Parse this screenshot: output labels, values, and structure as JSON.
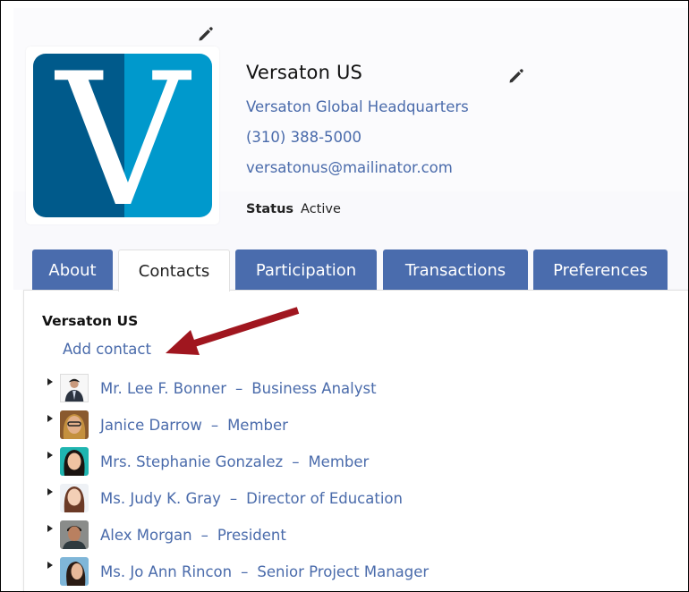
{
  "organization": {
    "name": "Versaton US",
    "subtitle": "Versaton Global Headquarters",
    "phone": "(310) 388-5000",
    "email": "versatonus@mailinator.com",
    "status_label": "Status",
    "status_value": "Active",
    "logo_letter": "V",
    "logo_colors": {
      "left": "#005a8b",
      "right": "#0099cc"
    }
  },
  "tabs": [
    {
      "label": "About",
      "active": false
    },
    {
      "label": "Contacts",
      "active": true
    },
    {
      "label": "Participation",
      "active": false
    },
    {
      "label": "Transactions",
      "active": false
    },
    {
      "label": "Preferences",
      "active": false
    }
  ],
  "contacts_panel": {
    "section_title": "Versaton US",
    "add_contact_label": "Add contact",
    "separator": "–",
    "contacts": [
      {
        "name": "Mr. Lee F. Bonner",
        "role": "Business Analyst"
      },
      {
        "name": "Janice Darrow",
        "role": "Member"
      },
      {
        "name": "Mrs. Stephanie Gonzalez",
        "role": "Member"
      },
      {
        "name": "Ms. Judy K. Gray",
        "role": "Director of Education"
      },
      {
        "name": "Alex Morgan",
        "role": "President"
      },
      {
        "name": "Ms. Jo Ann Rincon",
        "role": "Senior Project Manager"
      }
    ]
  },
  "colors": {
    "accent": "#4a6cad",
    "link": "#4a6bab",
    "annotation_arrow": "#a0161f"
  }
}
